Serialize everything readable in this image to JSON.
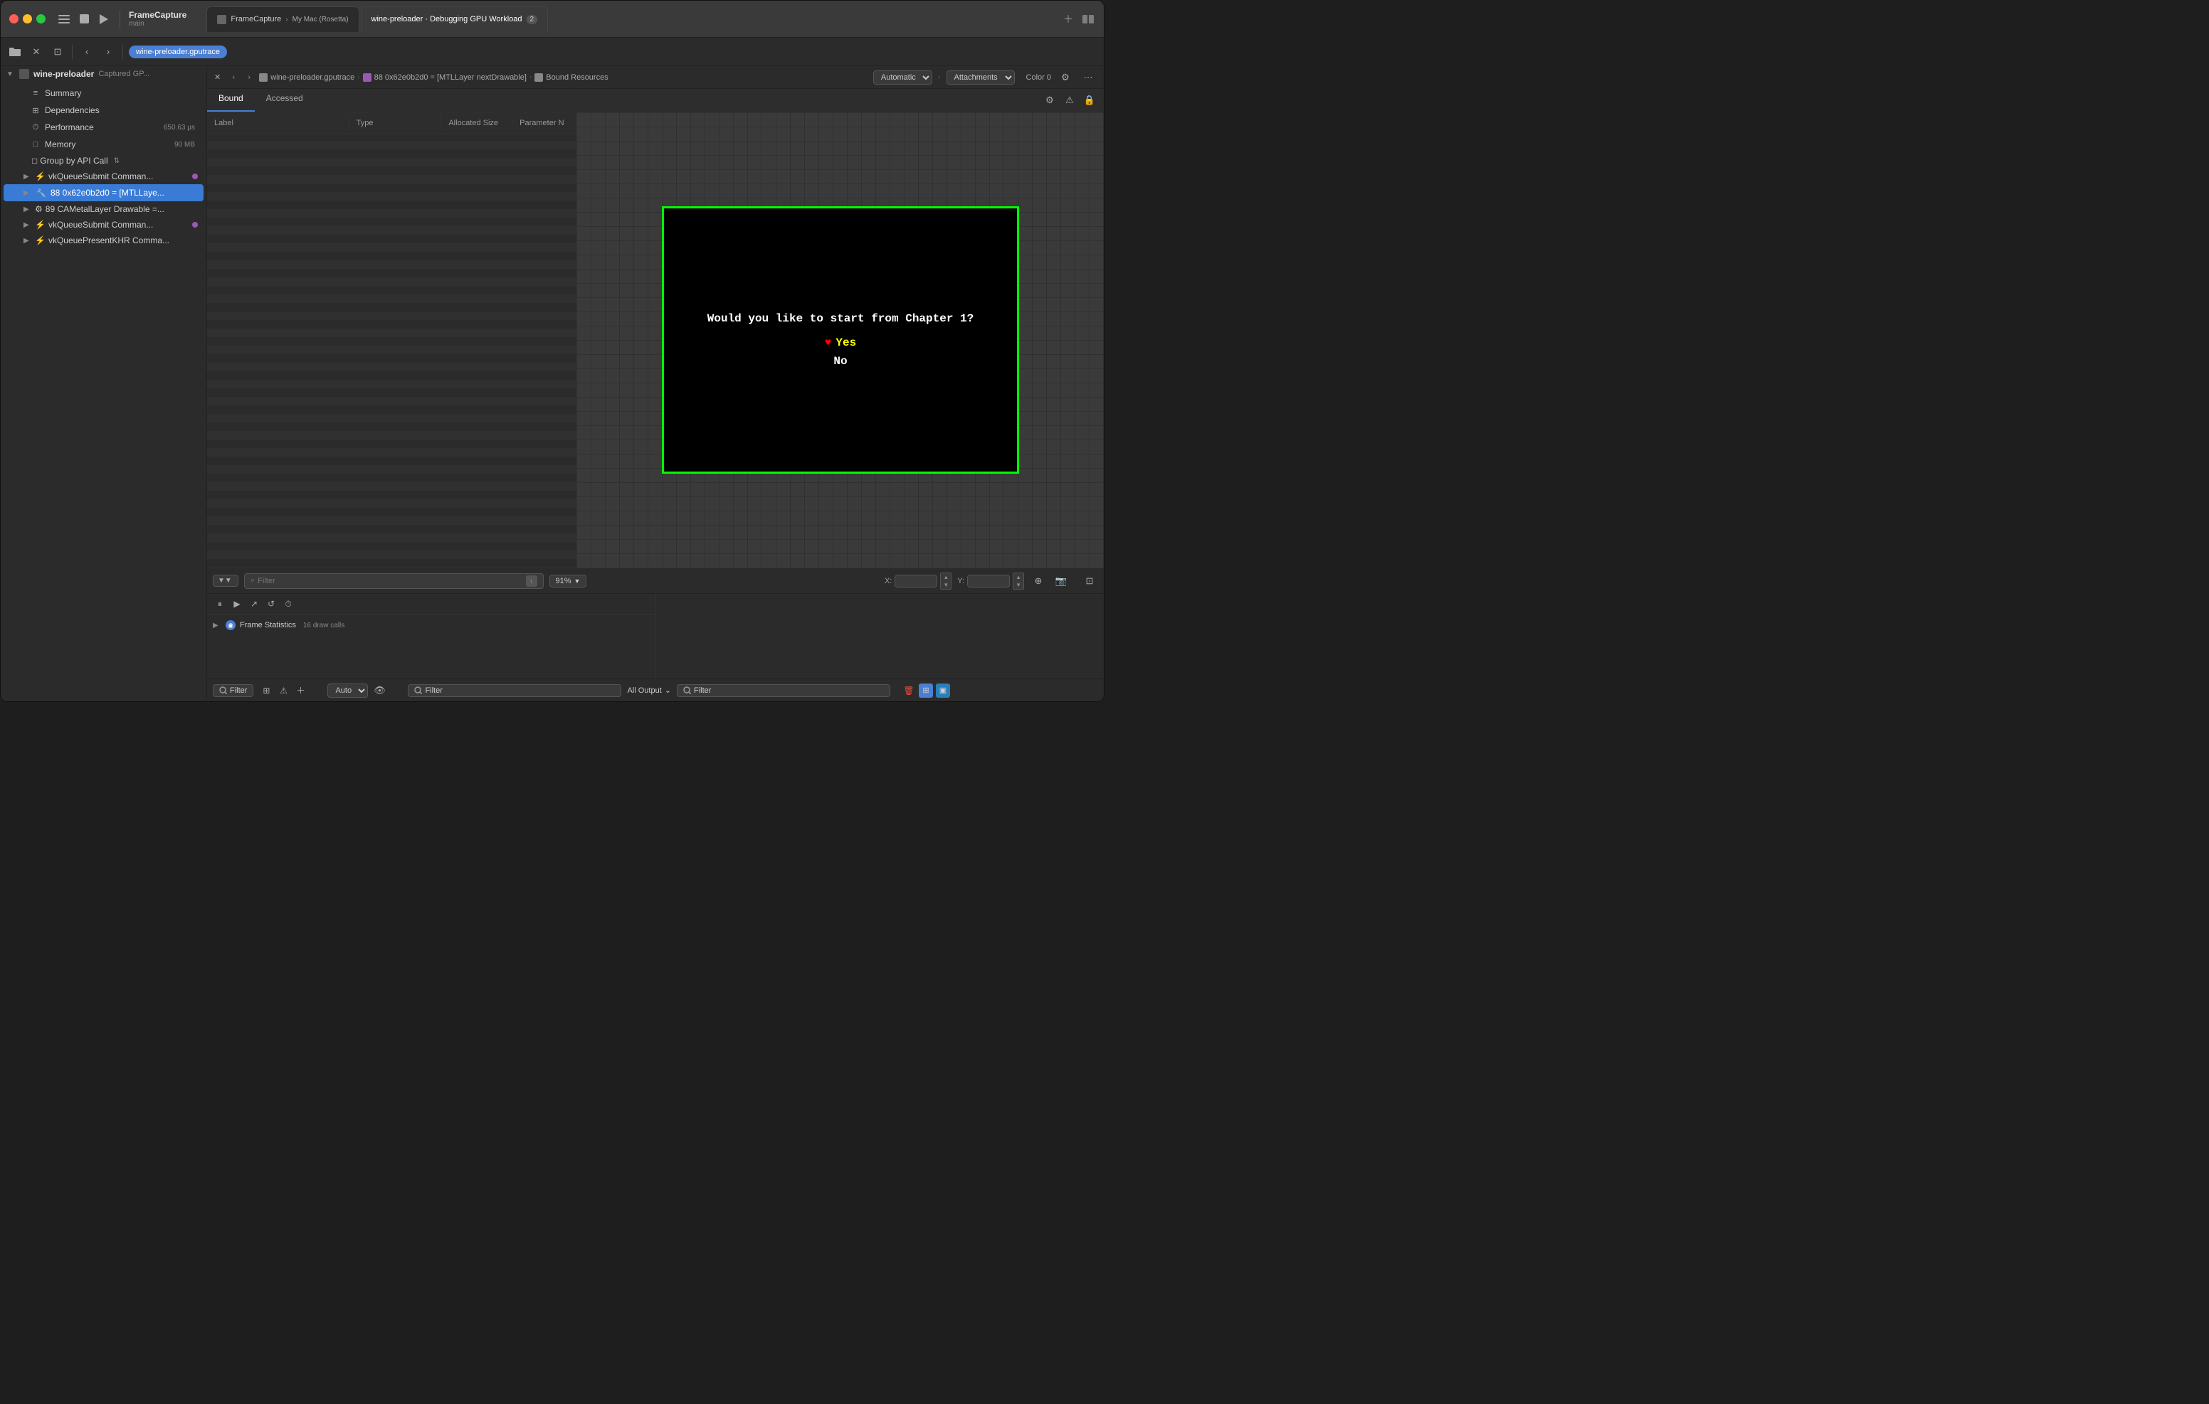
{
  "window": {
    "title": "FrameCapture",
    "subtitle": "main"
  },
  "tabs": [
    {
      "id": "framecapture",
      "label": "FrameCapture",
      "subtitle": "My Mac (Rosetta)",
      "active": false
    },
    {
      "id": "wine-debug",
      "label": "wine-preloader · Debugging GPU Workload",
      "badge": "2",
      "active": true
    }
  ],
  "toolbar": {
    "file_icon": "📁",
    "active_file": "wine-preloader.gputrace"
  },
  "sidebar": {
    "root_label": "wine-preloader",
    "root_sublabel": "Captured GP...",
    "items": [
      {
        "id": "summary",
        "label": "Summary",
        "icon": "≡",
        "active": false,
        "indent": 1
      },
      {
        "id": "dependencies",
        "label": "Dependencies",
        "icon": "⊞",
        "active": false,
        "indent": 1
      },
      {
        "id": "performance",
        "label": "Performance",
        "icon": "⏱",
        "active": false,
        "indent": 1,
        "badge": "650.63 µs"
      },
      {
        "id": "memory",
        "label": "Memory",
        "icon": "□",
        "active": false,
        "indent": 1,
        "badge": "90 MB"
      },
      {
        "id": "group_api",
        "label": "Group by API Call",
        "icon": "↕",
        "active": false,
        "indent": 2,
        "type": "select"
      },
      {
        "id": "vkqueue1",
        "label": "vkQueueSubmit Comman...",
        "icon": "⚡",
        "active": false,
        "indent": 2,
        "has_badge": true
      },
      {
        "id": "mtllayer",
        "label": "88 0x62e0b2d0 = [MTLLaye...",
        "icon": "🔧",
        "active": true,
        "indent": 2
      },
      {
        "id": "cametal",
        "label": "89 CAMetalLayer Drawable =...",
        "icon": "⚙",
        "active": false,
        "indent": 2
      },
      {
        "id": "vkqueue2",
        "label": "vkQueueSubmit Comman...",
        "icon": "⚡",
        "active": false,
        "indent": 2,
        "has_badge": true
      },
      {
        "id": "vkqueuepresent",
        "label": "vkQueuePresentKHR Comma...",
        "icon": "⚡",
        "active": false,
        "indent": 2
      }
    ]
  },
  "breadcrumb": {
    "items": [
      "wine-preloader.gputrace",
      "88 0x62e0b2d0 = [MTLLayer nextDrawable]",
      "Bound Resources"
    ],
    "right_options": [
      "Automatic",
      "Attachments"
    ],
    "label": "Color 0"
  },
  "content_tabs": [
    "Bound",
    "Accessed"
  ],
  "active_content_tab": "Bound",
  "table": {
    "columns": [
      "Label",
      "Type",
      "Allocated Size",
      "Parameter N"
    ],
    "rows": []
  },
  "preview": {
    "title": "Color 0",
    "game": {
      "question": "Would you like to start from Chapter 1?",
      "yes_label": "Yes",
      "no_label": "No"
    }
  },
  "bottom_toolbar": {
    "filter_placeholder": "Filter",
    "zoom": "91%",
    "x_label": "X:",
    "y_label": "Y:"
  },
  "bottom_panel": {
    "frame_stats_label": "Frame Statistics",
    "frame_stats_badge": "16 draw calls"
  },
  "status_bar": {
    "filter_label": "Filter",
    "auto_label": "Auto",
    "center_filter": "Filter",
    "all_output": "All Output",
    "right_filter": "Filter"
  }
}
